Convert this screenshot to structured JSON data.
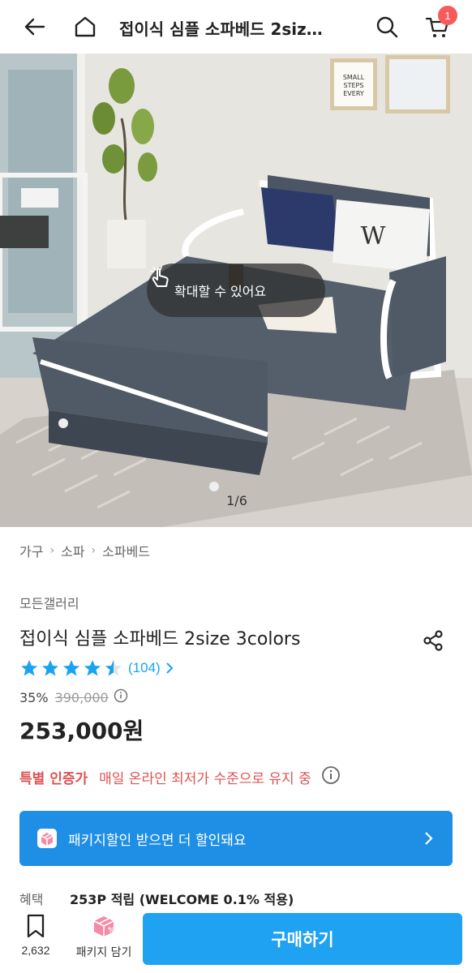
{
  "header": {
    "title": "접이식 심플 소파베드 2siz…",
    "cart_badge": "1"
  },
  "hero": {
    "zoom_hint": "확대할 수 있어요",
    "image_counter": "1/6",
    "frame_text": "SMALL STEPS EVERY DAY"
  },
  "breadcrumb": [
    "가구",
    "소파",
    "소파베드"
  ],
  "product": {
    "brand": "모든갤러리",
    "title": "접이식 심플 소파베드 2size 3colors",
    "rating_stars": 4.5,
    "review_count": "(104)",
    "discount": "35%",
    "original_price": "390,000",
    "price": "253,000원",
    "promo_label": "특별 인증가",
    "promo_message": "매일 온라인 최저가 수준으로 유지 중"
  },
  "banner": {
    "text": "패키지할인 받으면 더 할인돼요"
  },
  "benefit": {
    "label": "혜택",
    "value": "253P 적립 (WELCOME 0.1% 적용)"
  },
  "bottom": {
    "bookmark_count": "2,632",
    "package_label": "패키지 담기",
    "buy_label": "구매하기"
  },
  "colors": {
    "accent": "#1fa2f2",
    "banner": "#1f8fe6",
    "promo": "#e05151",
    "badge": "#f65a5a",
    "star": "#1aa3f0"
  }
}
